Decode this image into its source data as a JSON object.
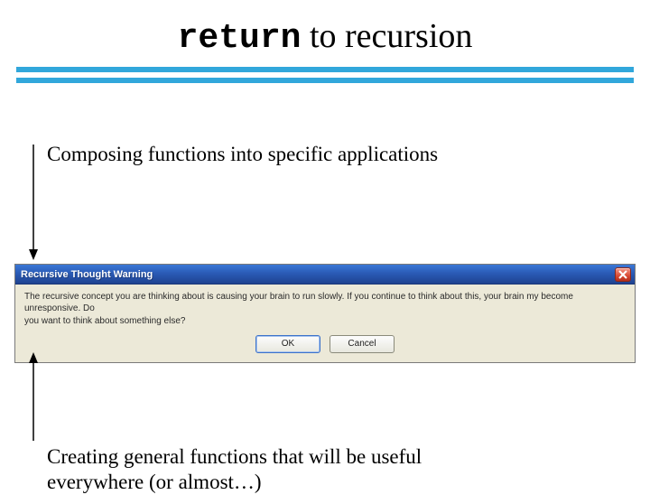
{
  "title": {
    "kw": "return",
    "rest": " to  recursion"
  },
  "subtitle1": "Composing functions into specific applications",
  "subtitle2_line1": "Creating general functions that will be useful",
  "subtitle2_line2": "everywhere (or almost…)",
  "dialog": {
    "title": "Recursive Thought Warning",
    "body_l1": "The recursive concept you are thinking about is causing your brain to run slowly. If you continue to think about this, your brain my become unresponsive. Do",
    "body_l2": "you want to think about something else?",
    "ok": "OK",
    "cancel": "Cancel"
  }
}
